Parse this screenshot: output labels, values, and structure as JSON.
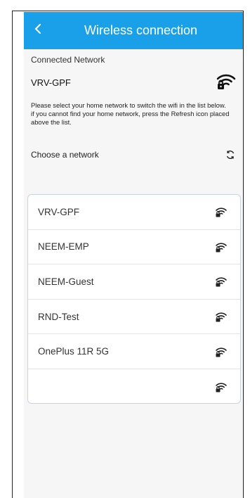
{
  "app_bar": {
    "title": "Wireless connection",
    "back_icon": "chevron-left-icon"
  },
  "connected": {
    "label": "Connected Network",
    "name": "VRV-GPF",
    "icon": "wifi-locked-icon"
  },
  "help_text": "Please select your home network to switch the wifi in the list below. if you cannot find your home network, press the Refresh icon placed above the list.",
  "choose": {
    "label": "Choose a network",
    "refresh_icon": "refresh-icon"
  },
  "networks": [
    {
      "name": "VRV-GPF",
      "icon": "wifi-locked-icon"
    },
    {
      "name": "NEEM-EMP",
      "icon": "wifi-locked-icon"
    },
    {
      "name": "NEEM-Guest",
      "icon": "wifi-locked-icon"
    },
    {
      "name": "RND-Test",
      "icon": "wifi-locked-icon"
    },
    {
      "name": "OnePlus 11R 5G",
      "icon": "wifi-locked-icon"
    },
    {
      "name": "",
      "icon": "wifi-locked-icon"
    }
  ],
  "colors": {
    "accent": "#1aa0e8",
    "background": "#f6f6f6"
  }
}
